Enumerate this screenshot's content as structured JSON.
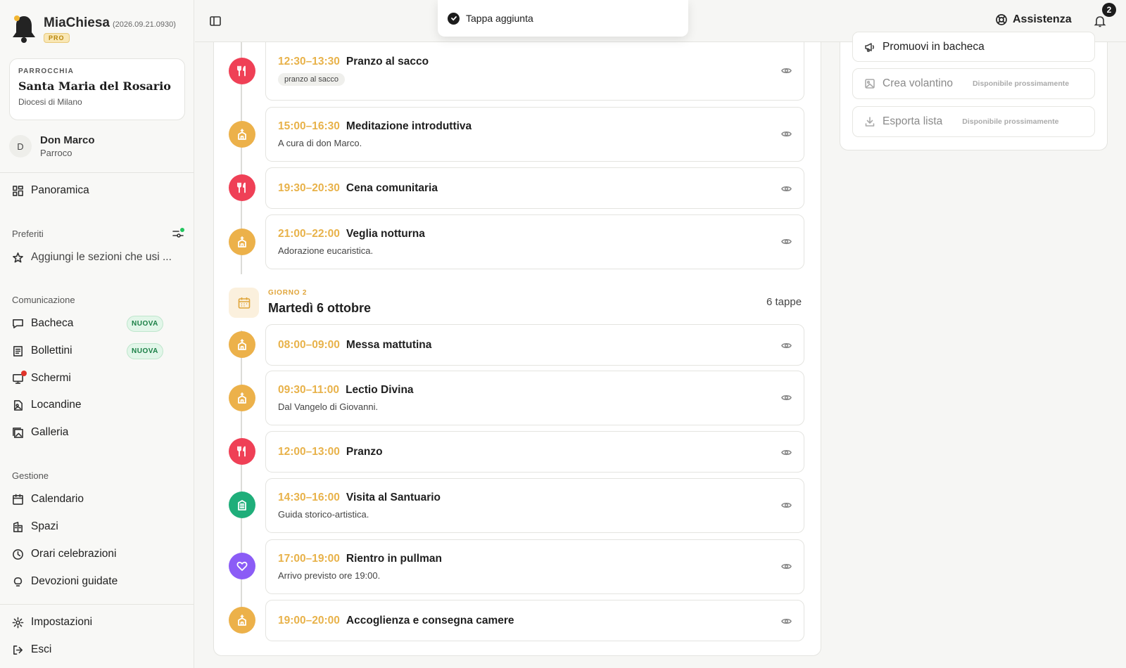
{
  "brand": {
    "name": "MiaChiesa",
    "version": "(2026.09.21.0930)",
    "plan": "PRO"
  },
  "parish": {
    "kicker": "PARROCCHIA",
    "name": "Santa Maria del Rosario",
    "diocese": "Diocesi di Milano"
  },
  "user": {
    "initial": "D",
    "name": "Don Marco",
    "role": "Parroco"
  },
  "sidebar": {
    "overview": "Panoramica",
    "favorites_label": "Preferiti",
    "favorites_placeholder": "Aggiungi le sezioni che usi ...",
    "communication_label": "Comunicazione",
    "communication": [
      {
        "label": "Bacheca",
        "badge": "NUOVA"
      },
      {
        "label": "Bollettini",
        "badge": "NUOVA"
      },
      {
        "label": "Schermi"
      },
      {
        "label": "Locandine"
      },
      {
        "label": "Galleria"
      }
    ],
    "management_label": "Gestione",
    "management": [
      {
        "label": "Calendario"
      },
      {
        "label": "Spazi"
      },
      {
        "label": "Orari celebrazioni"
      },
      {
        "label": "Devozioni guidate"
      }
    ],
    "settings": "Impostazioni",
    "logout": "Esci"
  },
  "topbar": {
    "help": "Assistenza",
    "notifications": "2"
  },
  "toast": {
    "message": "Tappa aggiunta"
  },
  "day1_stops": [
    {
      "time": "12:30–13:30",
      "name": "Pranzo al sacco",
      "tag": "pranzo al sacco",
      "type": "meal",
      "color": "#ef4056"
    },
    {
      "time": "15:00–16:30",
      "name": "Meditazione introduttiva",
      "desc": "A cura di don Marco.",
      "type": "church",
      "color": "#ecb14a"
    },
    {
      "time": "19:30–20:30",
      "name": "Cena comunitaria",
      "type": "meal",
      "color": "#ef4056"
    },
    {
      "time": "21:00–22:00",
      "name": "Veglia notturna",
      "desc": "Adorazione eucaristica.",
      "type": "church",
      "color": "#ecb14a"
    }
  ],
  "day2": {
    "kicker": "GIORNO 2",
    "title": "Martedì 6 ottobre",
    "count": "6 tappe",
    "stops": [
      {
        "time": "08:00–09:00",
        "name": "Messa mattutina",
        "type": "church",
        "color": "#ecb14a"
      },
      {
        "time": "09:30–11:00",
        "name": "Lectio Divina",
        "desc": "Dal Vangelo di Giovanni.",
        "type": "church",
        "color": "#ecb14a"
      },
      {
        "time": "12:00–13:00",
        "name": "Pranzo",
        "type": "meal",
        "color": "#ef4056"
      },
      {
        "time": "14:30–16:00",
        "name": "Visita al Santuario",
        "desc": "Guida storico-artistica.",
        "type": "building",
        "color": "#1fae7a"
      },
      {
        "time": "17:00–19:00",
        "name": "Rientro in pullman",
        "desc": "Arrivo previsto ore 19:00.",
        "type": "heart",
        "color": "#8b5cf6"
      },
      {
        "time": "19:00–20:00",
        "name": "Accoglienza e consegna camere",
        "type": "church",
        "color": "#ecb14a"
      }
    ]
  },
  "actions": {
    "promote": "Promuovi in bacheca",
    "flyer": "Crea volantino",
    "export": "Esporta lista",
    "soon": "Disponibile prossimamente"
  }
}
